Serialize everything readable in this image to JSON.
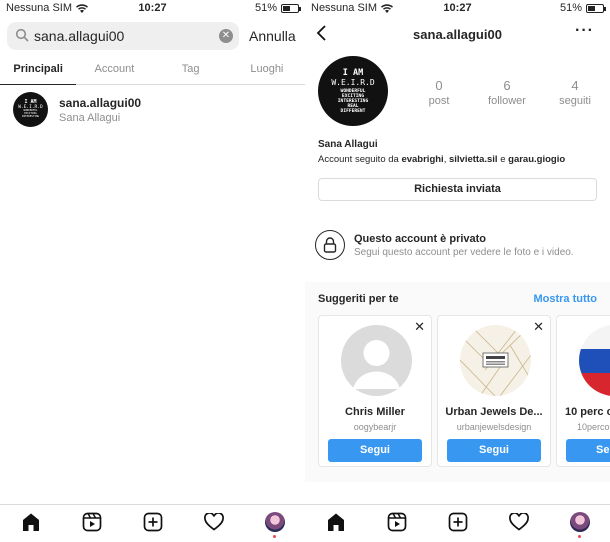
{
  "status_left": {
    "carrier": "Nessuna SIM",
    "time": "10:27",
    "battery": "51%",
    "battery_level": 0.51
  },
  "status_right": {
    "carrier": "Nessuna SIM",
    "time": "10:27",
    "battery": "51%",
    "battery_level": 0.51
  },
  "search": {
    "query": "sana.allagui00",
    "cancel_label": "Annulla",
    "tabs": [
      {
        "label": "Principali",
        "active": true
      },
      {
        "label": "Account",
        "active": false
      },
      {
        "label": "Tag",
        "active": false
      },
      {
        "label": "Luoghi",
        "active": false
      }
    ],
    "results": [
      {
        "username": "sana.allagui00",
        "full_name": "Sana Allagui"
      }
    ]
  },
  "logo_text": {
    "line1": "I AM",
    "line2": "W.E.I.R.D",
    "line3": "WONDERFUL",
    "line4": "EXCITING",
    "line5": "INTERESTING",
    "line6": "REAL",
    "line7": "DIFFERENT"
  },
  "profile": {
    "username": "sana.allagui00",
    "stats": [
      {
        "value": "0",
        "label": "post"
      },
      {
        "value": "6",
        "label": "follower"
      },
      {
        "value": "4",
        "label": "seguiti"
      }
    ],
    "name": "Sana Allagui",
    "followed_by_prefix": "Account seguito da ",
    "followed_by_1": "evabrighi",
    "sep1": ", ",
    "followed_by_2": "silvietta.sil",
    "sep2": " e ",
    "followed_by_3": "garau.giogio",
    "request_button": "Richiesta inviata",
    "private_title": "Questo account è privato",
    "private_subtitle": "Segui questo account per vedere le foto e i video."
  },
  "suggestions": {
    "title": "Suggeriti per te",
    "see_all": "Mostra tutto",
    "cards": [
      {
        "name": "Chris Miller",
        "username": "oogybearjr",
        "follow_label": "Segui"
      },
      {
        "name": "Urban Jewels De...",
        "username": "urbanjewelsdesign",
        "follow_label": "Segui"
      },
      {
        "name": "10 perc o",
        "username": "10perco",
        "follow_label": "Se"
      }
    ]
  },
  "tabbar_icons": [
    "home-icon",
    "reels-icon",
    "new-post-icon",
    "activity-heart-icon",
    "profile-avatar-icon"
  ],
  "colors": {
    "accent": "#3897f0",
    "text": "#262626",
    "muted": "#8e8e8e",
    "border": "#dbdbdb",
    "notification": "#ed4956"
  }
}
